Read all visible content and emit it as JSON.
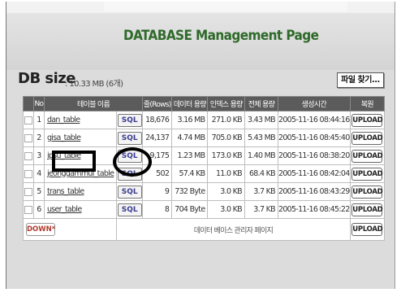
{
  "page": {
    "title": "DATABASE Management Page",
    "db_size_label": "DB size",
    "db_size_value": ": 10.33 MB (6개)",
    "find_file_button": "파일 찾기..."
  },
  "table": {
    "headers": [
      "No",
      "테이블 이름",
      "줄(Rows)",
      "데이터 용량",
      "인덱스 용량",
      "전체 용량",
      "생성시간",
      "복원"
    ],
    "sql_label": "SQL",
    "upload_label": "UPLOAD",
    "rows": [
      {
        "no": "1",
        "name": "dan_table",
        "rows": "18,676",
        "data": "3.16 MB",
        "index": "271.0 KB",
        "total": "3.43 MB",
        "created": "2005-11-16 08:44:16"
      },
      {
        "no": "2",
        "name": "gisa_table",
        "rows": "24,137",
        "data": "4.74 MB",
        "index": "705.0 KB",
        "total": "5.43 MB",
        "created": "2005-11-16 08:45:40"
      },
      {
        "no": "3",
        "name": "ipsu_table",
        "rows": "9,175",
        "data": "1.23 MB",
        "index": "173.0 KB",
        "total": "1.40 MB",
        "created": "2005-11-16 08:38:20"
      },
      {
        "no": "4",
        "name": "jeonggammul_table",
        "rows": "502",
        "data": "57.4 KB",
        "index": "11.0 KB",
        "total": "68.4 KB",
        "created": "2005-11-16 08:42:04"
      },
      {
        "no": "5",
        "name": "trans_table",
        "rows": "9",
        "data": "732 Byte",
        "index": "3.0 KB",
        "total": "3.7 KB",
        "created": "2005-11-16 08:43:29"
      },
      {
        "no": "6",
        "name": "user_table",
        "rows": "8",
        "data": "704 Byte",
        "index": "3.0 KB",
        "total": "3.7 KB",
        "created": "2005-11-16 08:45:22"
      }
    ],
    "footer": {
      "down_label": "DOWN*",
      "caption": "데이터 베이스 관리자 페이지",
      "upload_label": "UPLOAD"
    }
  },
  "colors": {
    "title_green": "#2f6a2a",
    "header_bg": "#5b5b5b",
    "sql_text": "#3b3b8f",
    "down_text": "#b03a2e"
  }
}
